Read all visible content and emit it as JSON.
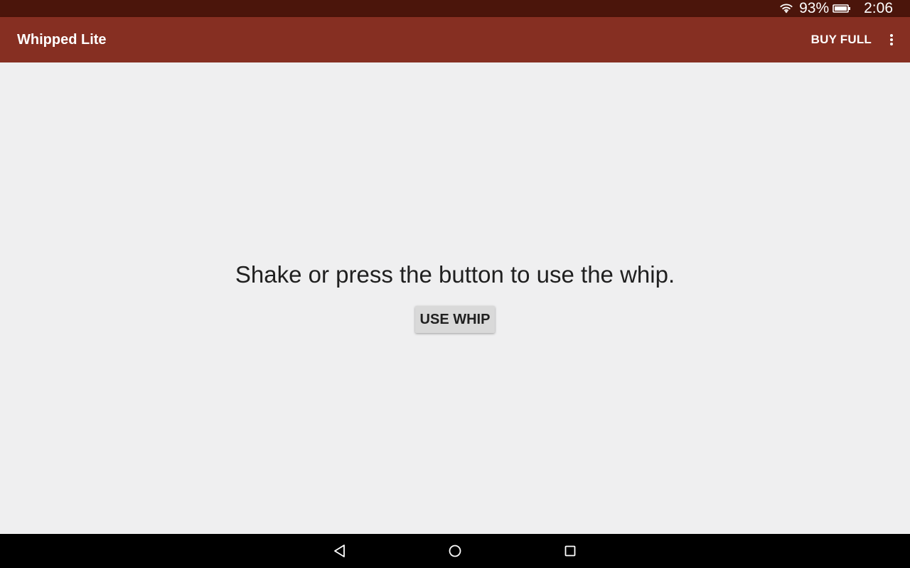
{
  "status_bar": {
    "battery_percent": "93%",
    "time": "2:06",
    "icons": [
      "wifi-icon",
      "battery-icon"
    ]
  },
  "app_bar": {
    "title": "Whipped Lite",
    "buy_full_label": "BUY FULL",
    "overflow_icon": "more-vert-icon",
    "background": "#862f22"
  },
  "main": {
    "message": "Shake or press the button to use the whip.",
    "use_whip_label": "USE WHIP"
  },
  "nav_bar": {
    "icons": [
      "back-icon",
      "home-icon",
      "recents-icon"
    ]
  },
  "colors": {
    "status_bar": "#4b150b",
    "app_bar": "#862f22",
    "background": "#efeff0",
    "button": "#d9d9d9"
  }
}
